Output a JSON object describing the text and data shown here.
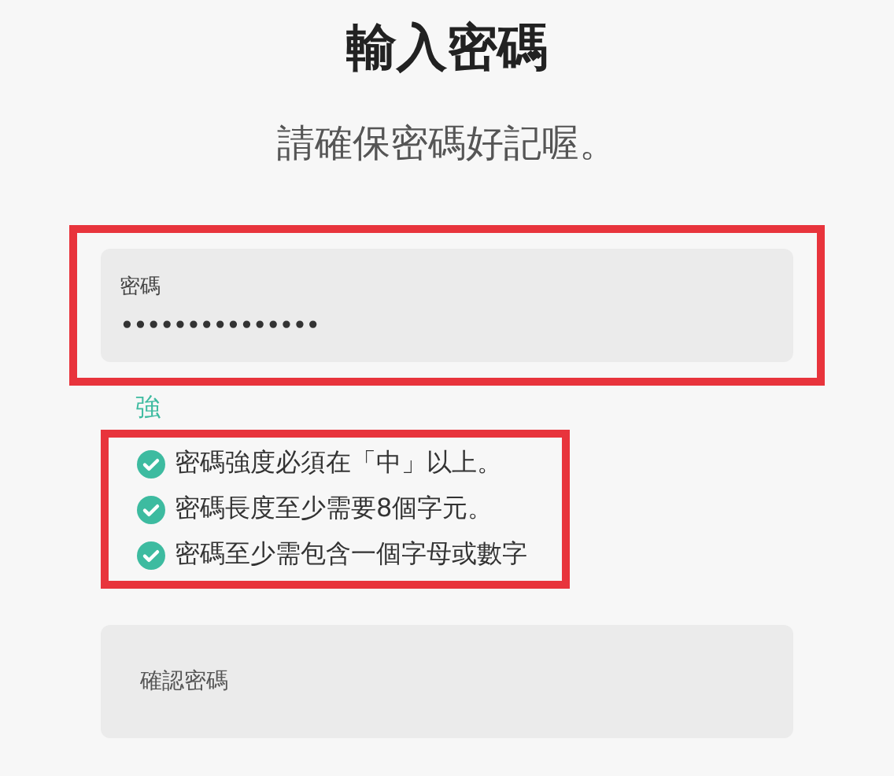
{
  "title": "輸入密碼",
  "subtitle": "請確保密碼好記喔。",
  "password_field": {
    "label": "密碼",
    "value": "•••••••••••••••",
    "highlighted": true
  },
  "strength_label": "強",
  "requirements": {
    "highlighted": true,
    "items": [
      {
        "text": "密碼強度必須在「中」以上。",
        "met": true
      },
      {
        "text": "密碼長度至少需要8個字元。",
        "met": true
      },
      {
        "text": "密碼至少需包含一個字母或數字",
        "met": true
      }
    ]
  },
  "confirm_field": {
    "placeholder": "確認密碼"
  }
}
